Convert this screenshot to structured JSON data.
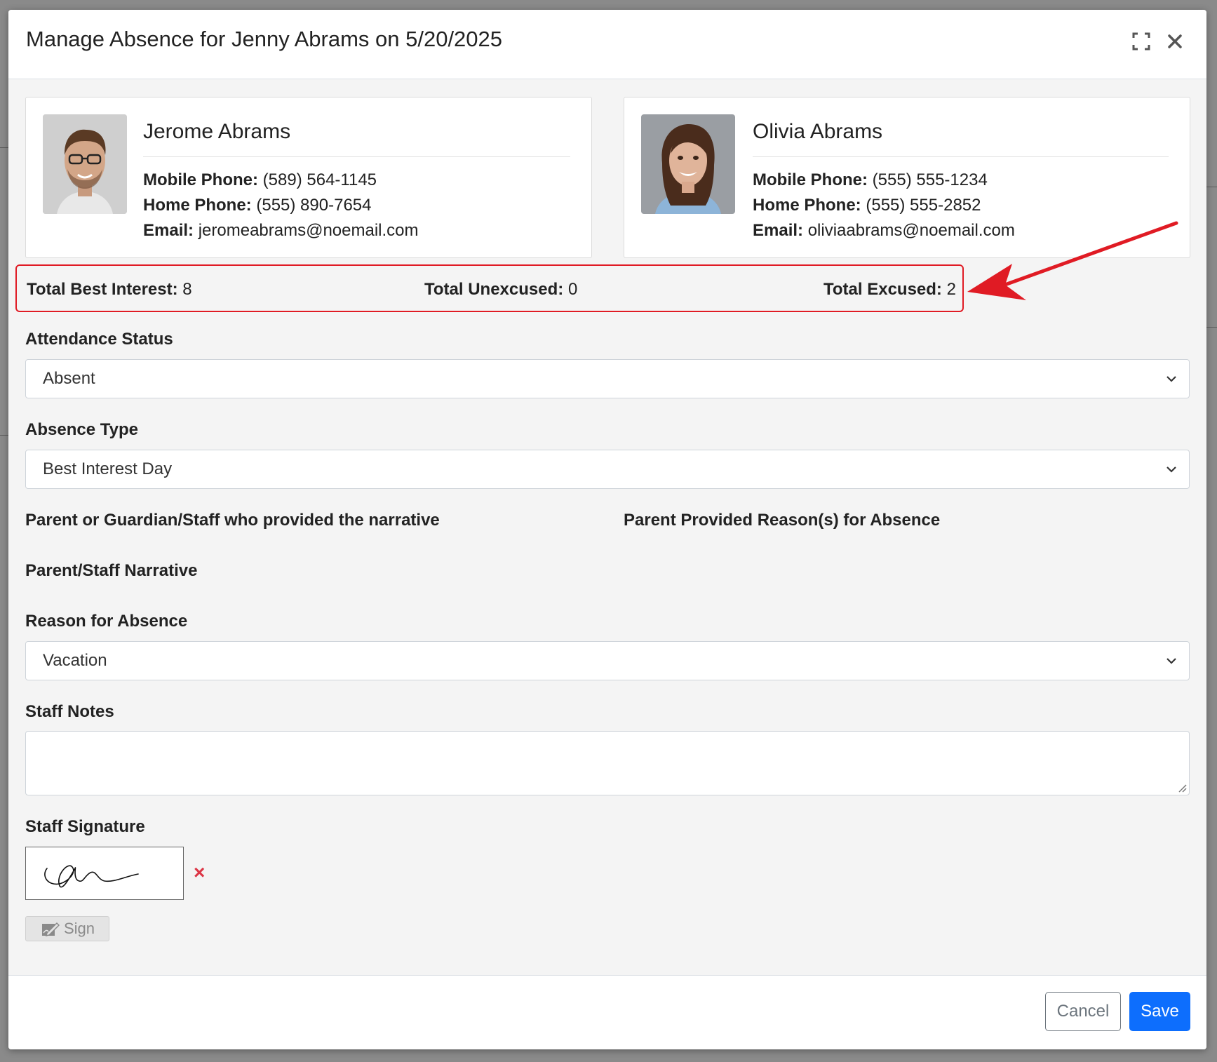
{
  "modal": {
    "title": "Manage Absence for Jenny Abrams on 5/20/2025"
  },
  "contacts": [
    {
      "name": "Jerome Abrams",
      "mobile_label": "Mobile Phone:",
      "mobile": "(589) 564-1145",
      "home_label": "Home Phone:",
      "home": "(555) 890-7654",
      "email_label": "Email:",
      "email": "jeromeabrams@noemail.com"
    },
    {
      "name": "Olivia Abrams",
      "mobile_label": "Mobile Phone:",
      "mobile": "(555) 555-1234",
      "home_label": "Home Phone:",
      "home": "(555) 555-2852",
      "email_label": "Email:",
      "email": "oliviaabrams@noemail.com"
    }
  ],
  "totals": {
    "best_interest_label": "Total Best Interest:",
    "best_interest": "8",
    "unexcused_label": "Total Unexcused:",
    "unexcused": "0",
    "excused_label": "Total Excused:",
    "excused": "2"
  },
  "form": {
    "attendance_status_label": "Attendance Status",
    "attendance_status_value": "Absent",
    "absence_type_label": "Absence Type",
    "absence_type_value": "Best Interest Day",
    "narrative_provider_label": "Parent or Guardian/Staff who provided the narrative",
    "parent_reasons_label": "Parent Provided Reason(s) for Absence",
    "narrative_label": "Parent/Staff Narrative",
    "reason_label": "Reason for Absence",
    "reason_value": "Vacation",
    "staff_notes_label": "Staff Notes",
    "staff_notes_value": "",
    "signature_label": "Staff Signature",
    "sign_button": "Sign",
    "clear_signature_glyph": "×"
  },
  "footer": {
    "cancel": "Cancel",
    "save": "Save"
  },
  "colors": {
    "accent": "#0d6efd",
    "highlight": "#e01b24",
    "danger": "#dc3545"
  }
}
